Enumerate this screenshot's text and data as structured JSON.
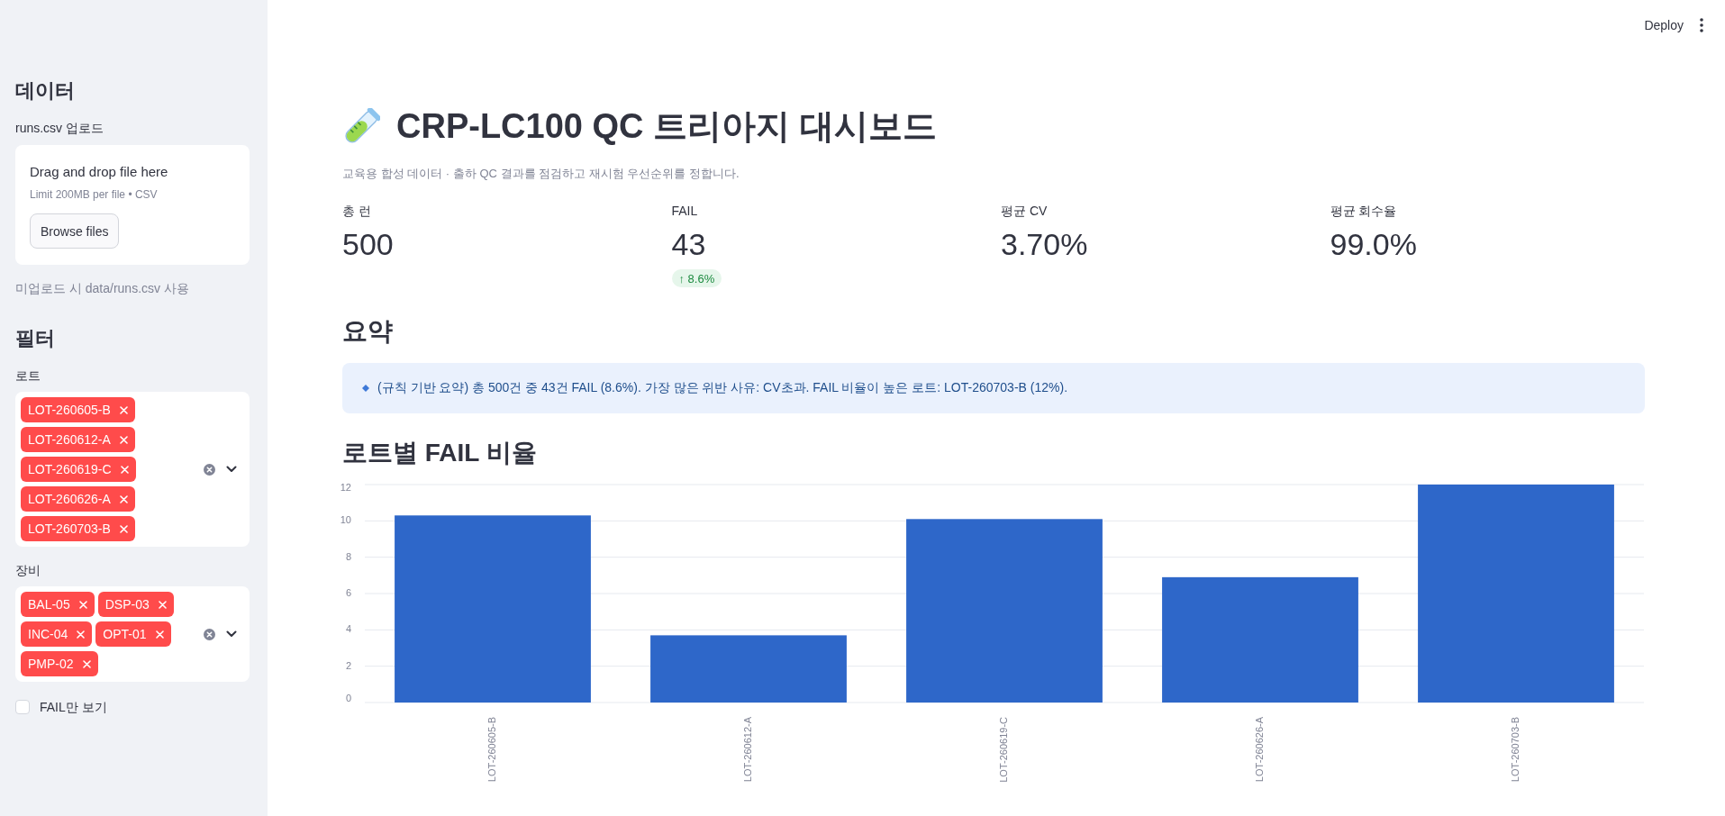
{
  "header": {
    "deploy_label": "Deploy"
  },
  "sidebar": {
    "data_section": {
      "heading": "데이터",
      "uploader": {
        "label": "runs.csv 업로드",
        "dropzone_text": "Drag and drop file here",
        "limit_text": "Limit 200MB per file • CSV",
        "button": "Browse files"
      },
      "caption": "미업로드 시 data/runs.csv 사용"
    },
    "filter_section": {
      "heading": "필터",
      "lot_select": {
        "label": "로트",
        "tags": [
          "LOT-260605-B",
          "LOT-260612-A",
          "LOT-260619-C",
          "LOT-260626-A",
          "LOT-260703-B"
        ]
      },
      "equipment_select": {
        "label": "장비",
        "tags": [
          "BAL-05",
          "DSP-03",
          "INC-04",
          "OPT-01",
          "PMP-02"
        ]
      },
      "fail_only": {
        "label": "FAIL만 보기",
        "checked": false
      }
    }
  },
  "main": {
    "title": "CRP-LC100 QC 트리아지 대시보드",
    "subtitle": "교육용 합성 데이터 · 출하 QC 결과를 점검하고 재시험 우선순위를 정합니다.",
    "metrics": [
      {
        "label": "총 런",
        "value": "500"
      },
      {
        "label": "FAIL",
        "value": "43",
        "delta": "↑ 8.6%"
      },
      {
        "label": "평균 CV",
        "value": "3.70%"
      },
      {
        "label": "평균 회수율",
        "value": "99.0%"
      }
    ],
    "summary": {
      "heading": "요약",
      "text": "(규칙 기반 요약) 총 500건 중 43건 FAIL (8.6%). 가장 많은 위반 사유: CV초과. FAIL 비율이 높은 로트: LOT-260703-B (12%)."
    },
    "fail_rate": {
      "heading": "로트별 FAIL 비율",
      "chart_data": {
        "type": "bar",
        "categories": [
          "LOT-260605-B",
          "LOT-260612-A",
          "LOT-260619-C",
          "LOT-260626-A",
          "LOT-260703-B"
        ],
        "values": [
          10.3,
          3.7,
          10.1,
          6.9,
          12.0
        ],
        "ylim": [
          0,
          12
        ],
        "yticks": [
          0,
          2,
          4,
          6,
          8,
          10,
          12
        ],
        "grid": true
      }
    }
  }
}
